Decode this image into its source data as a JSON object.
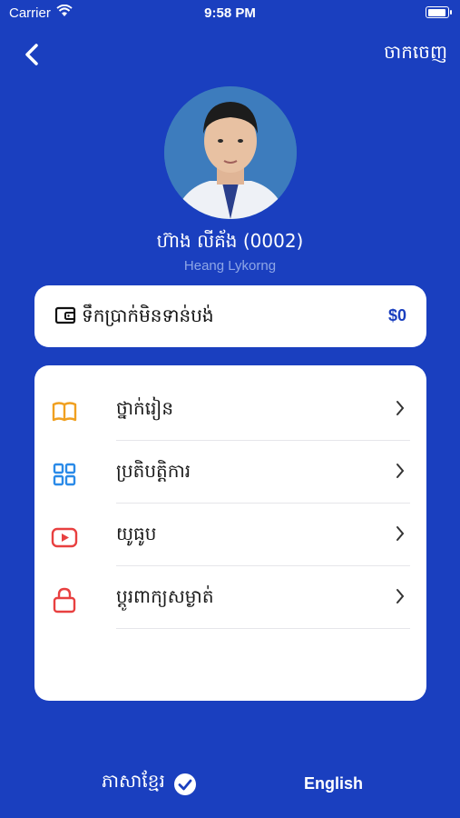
{
  "status_bar": {
    "carrier": "Carrier",
    "time": "9:58 PM"
  },
  "header": {
    "back_icon": "chevron-left-icon",
    "logout_label": "ចាកចេញ"
  },
  "profile": {
    "name": "ហ៊ាង លីគ័ង (0002)",
    "latin_name": "Heang Lykorng"
  },
  "balance": {
    "icon": "wallet-icon",
    "label": "ទឹកប្រាក់មិនទាន់បង់",
    "value": "$0"
  },
  "menu": {
    "items": [
      {
        "label": "ថ្នាក់រៀន",
        "icon": "book-icon",
        "color": "#f0a020"
      },
      {
        "label": "ប្រតិបត្តិការ",
        "icon": "grid-icon",
        "color": "#2a8ae8"
      },
      {
        "label": "យូធូប",
        "icon": "youtube-icon",
        "color": "#e84040"
      },
      {
        "label": "ប្តូរពាក្យសម្ងាត់",
        "icon": "lock-icon",
        "color": "#e84040"
      }
    ]
  },
  "language": {
    "khmer_label": "ភាសាខ្មែរ",
    "english_label": "English",
    "selected": "khmer"
  },
  "colors": {
    "background": "#1a3fbf",
    "accent": "#1a3fbf"
  }
}
